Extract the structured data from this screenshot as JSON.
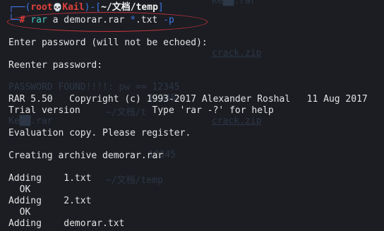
{
  "background_text": [
    "Ke██.rar",
    "PASSWORD FOUND!!!!: pw == 12345",
    "12345",
    "~/文档/t",
    "Ke██.rar",
    "crack.zip",
    "crack.zip",
    "12345",
    "~/文档/temp"
  ],
  "prompt": {
    "corner_top": "┌──(",
    "user": "root",
    "skull": "💀",
    "host": "Kail",
    "mid": ")-[",
    "path": "~/文档/temp",
    "close": "]",
    "corner_bottom": "└─",
    "hash": "#"
  },
  "command": {
    "program": "rar",
    "args": "a demorar.rar ",
    "glob": "*",
    "ext": ".txt ",
    "flag": "-p"
  },
  "output": {
    "enter_password": "Enter password (will not be echoed):",
    "reenter_password": "Reenter password:",
    "copyright": "RAR 5.50   Copyright (c) 1993-2017 Alexander Roshal   11 Aug 2017",
    "trial": "Trial version             Type 'rar -?' for help",
    "evaluation": "Evaluation copy. Please register.",
    "creating": "Creating archive demorar.rar",
    "adding1": "Adding    1.txt",
    "ok1": "  OK",
    "adding2": "Adding    2.txt",
    "ok2": "  OK",
    "adding3": "Adding    demorar.txt"
  }
}
